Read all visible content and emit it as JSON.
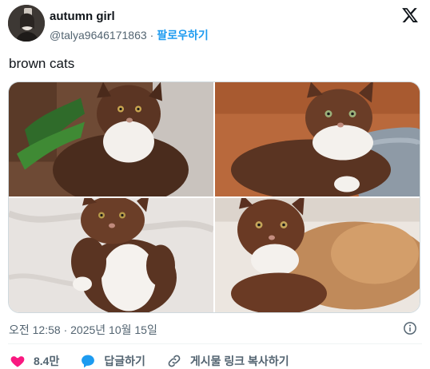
{
  "author": {
    "display_name": "autumn girl",
    "handle": "@talya9646171863",
    "separator": "·",
    "follow_label": "팔로우하기"
  },
  "tweet": {
    "text": "brown cats",
    "timestamp": "오전 12:58 · 2025년 10월 15일"
  },
  "photos": [
    {
      "subject": "brown cat with white chest near plant"
    },
    {
      "subject": "brown cat lying on couch"
    },
    {
      "subject": "brown cat on back on white bedding"
    },
    {
      "subject": "brown cat with long fluffy fur"
    }
  ],
  "actions": {
    "like_count": "8.4만",
    "reply_label": "답글하기",
    "copy_link_label": "게시물 링크 복사하기"
  },
  "colors": {
    "accent": "#1d9bf0",
    "like": "#f91880",
    "secondary_text": "#536471",
    "primary_text": "#0f1419"
  },
  "icons": [
    "x-logo-icon",
    "info-icon",
    "heart-icon",
    "reply-icon",
    "link-icon"
  ]
}
